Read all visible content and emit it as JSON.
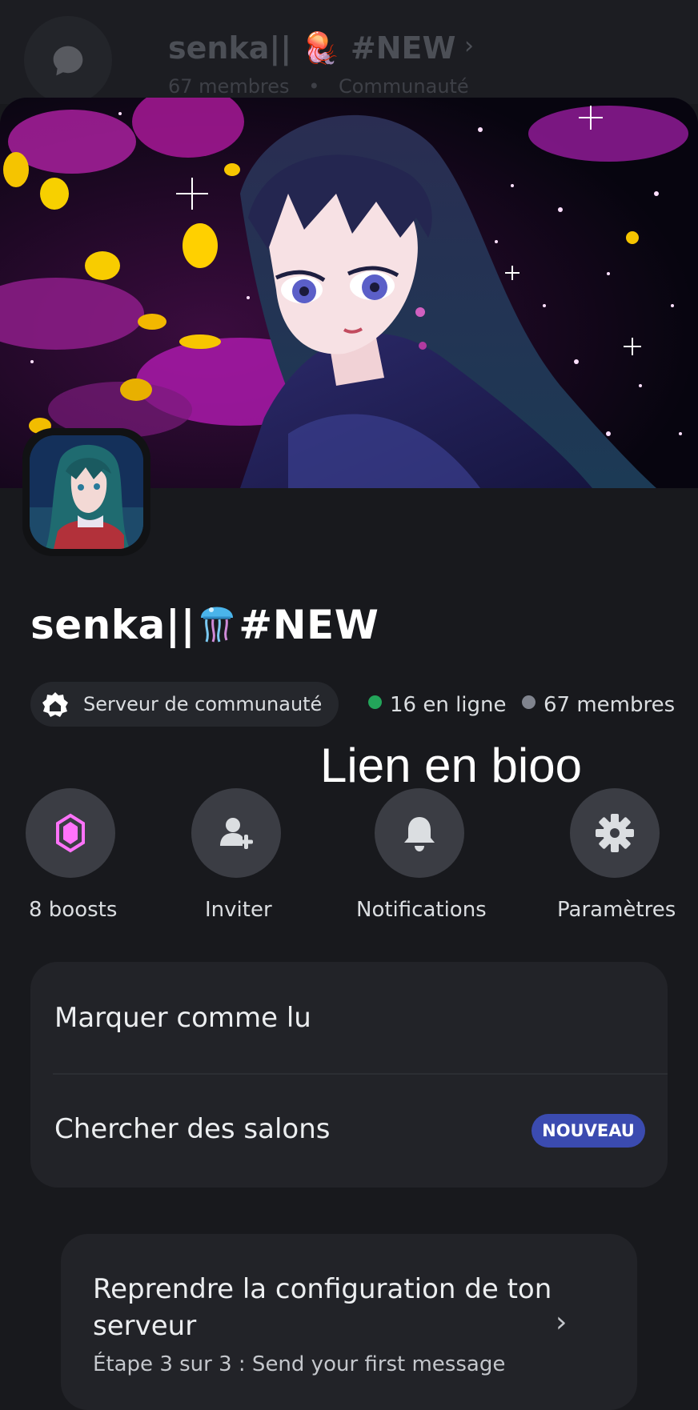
{
  "header": {
    "title": "senka|| 🪼 #NEW",
    "members": "67 membres",
    "separator": "•",
    "community": "Communauté"
  },
  "server": {
    "name_prefix": "senka||",
    "name_suffix": "#NEW",
    "community_label": "Serveur de communauté",
    "online": "16 en ligne",
    "members": "67 membres",
    "online_color": "#23a55a",
    "members_color": "#80848e"
  },
  "overlay": {
    "text": "Lien en bioo"
  },
  "actions": {
    "boosts": "8 boosts",
    "invite": "Inviter",
    "notifications": "Notifications",
    "settings": "Paramètres"
  },
  "menu": {
    "mark_read": "Marquer comme lu",
    "search_channels": "Chercher des salons",
    "new_badge": "NOUVEAU"
  },
  "setup": {
    "title": "Reprendre la configuration de ton serveur",
    "subtitle": "Étape 3 sur 3 : Send your first message"
  },
  "colors": {
    "background": "#18191d",
    "card": "#222328",
    "badge": "#3b4bb0",
    "boost": "#ff73fa"
  }
}
